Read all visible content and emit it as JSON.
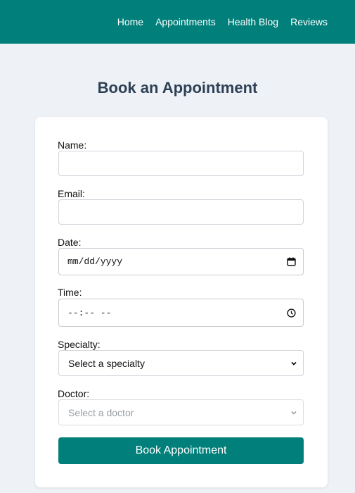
{
  "nav": {
    "items": [
      {
        "label": "Home"
      },
      {
        "label": "Appointments"
      },
      {
        "label": "Health Blog"
      },
      {
        "label": "Reviews"
      }
    ]
  },
  "page": {
    "title": "Book an Appointment"
  },
  "form": {
    "name": {
      "label": "Name:",
      "value": "",
      "placeholder": ""
    },
    "email": {
      "label": "Email:",
      "value": "",
      "placeholder": ""
    },
    "date": {
      "label": "Date:",
      "value": "mm/dd/yyyy",
      "icon": "calendar-icon"
    },
    "time": {
      "label": "Time:",
      "value": "--:-- --",
      "icon": "clock-icon"
    },
    "specialty": {
      "label": "Specialty:",
      "selected": "Select a specialty"
    },
    "doctor": {
      "label": "Doctor:",
      "selected": "Select a doctor",
      "disabled": true
    },
    "submit_label": "Book Appointment"
  },
  "colors": {
    "brand": "#017f7a",
    "title": "#2e4056",
    "background": "#eef2f7"
  }
}
